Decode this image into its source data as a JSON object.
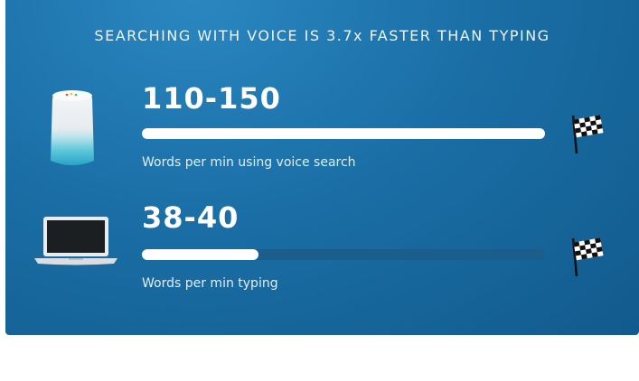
{
  "headline": "SEARCHING WITH VOICE IS 3.7x FASTER THAN TYPING",
  "stats": [
    {
      "value": "110-150",
      "caption": "Words per min using voice search",
      "progress": 1.0,
      "icon": "smart-speaker-icon"
    },
    {
      "value": "38-40",
      "caption": "Words per min typing",
      "progress": 0.29,
      "icon": "laptop-icon"
    }
  ],
  "finish_icon": "checkered-flag-icon",
  "colors": {
    "background": "#1a6fa6",
    "bar_track": "#1b5d8b",
    "bar_fill": "#ffffff",
    "text": "#ffffff"
  }
}
